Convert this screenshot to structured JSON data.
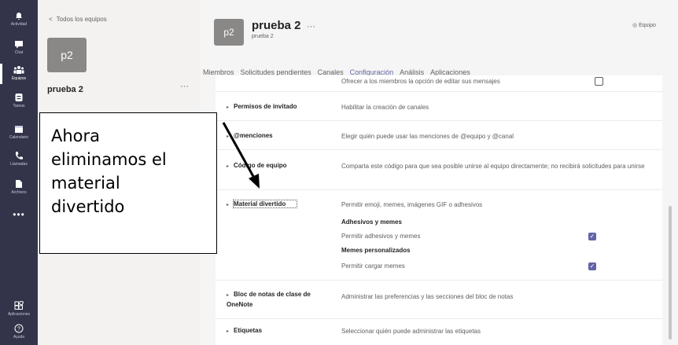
{
  "rail": {
    "items": [
      {
        "label": "Actividad",
        "icon": "bell-icon"
      },
      {
        "label": "Chat",
        "icon": "chat-icon"
      },
      {
        "label": "Equipos",
        "icon": "teams-icon"
      },
      {
        "label": "Tareas",
        "icon": "tasks-icon"
      },
      {
        "label": "Calendario",
        "icon": "calendar-icon"
      },
      {
        "label": "Llamadas",
        "icon": "phone-icon"
      },
      {
        "label": "Archivos",
        "icon": "files-icon"
      }
    ],
    "more": "•••",
    "bottom": [
      {
        "label": "Aplicaciones",
        "icon": "apps-icon"
      },
      {
        "label": "Ayuda",
        "icon": "help-icon"
      }
    ]
  },
  "left": {
    "back_label": "Todos los equipos",
    "avatar": "p2",
    "team_name": "prueba 2",
    "more": "···"
  },
  "header": {
    "avatar": "p2",
    "title": "prueba 2",
    "title_more": "···",
    "subtitle": "prueba 2",
    "team_button": "Equipo"
  },
  "tabs": [
    "Miembros",
    "Solicitudes pendientes",
    "Canales",
    "Configuración",
    "Análisis",
    "Aplicaciones"
  ],
  "settings": {
    "top_desc": "Ofrecer a los miembros la opción de editar sus mensajes",
    "rows": [
      {
        "title": "Permisos de invitado",
        "desc": "Habilitar la creación de canales"
      },
      {
        "title": "@menciones",
        "desc": "Elegir quién puede usar las menciones de @equipo y @canal"
      },
      {
        "title": "Código de equipo",
        "desc": "Comparta este código para que sea posible unirse al equipo directamente; no recibirá solicitudes para unirse"
      },
      {
        "title": "Material divertido",
        "desc": "Permitir emoji, memes, imágenes GIF o adhesivos"
      },
      {
        "title": "Bloc de notas de clase de OneNote",
        "desc": "Administrar las preferencias y las secciones del bloc de notas"
      },
      {
        "title": "Etiquetas",
        "desc": "Seleccionar quién puede administrar las etiquetas"
      }
    ],
    "fun": {
      "stickers_header": "Adhesivos y memes",
      "stickers_option": "Permitir adhesivos y memes",
      "stickers_checked": true,
      "custom_header": "Memes personalizados",
      "custom_option": "Permitir cargar memes",
      "custom_checked": true
    }
  },
  "callout": {
    "lines": [
      "Ahora",
      "eliminamos el",
      "material",
      "divertido"
    ]
  },
  "colors": {
    "rail": "#33344a",
    "accent": "#6264a7"
  }
}
